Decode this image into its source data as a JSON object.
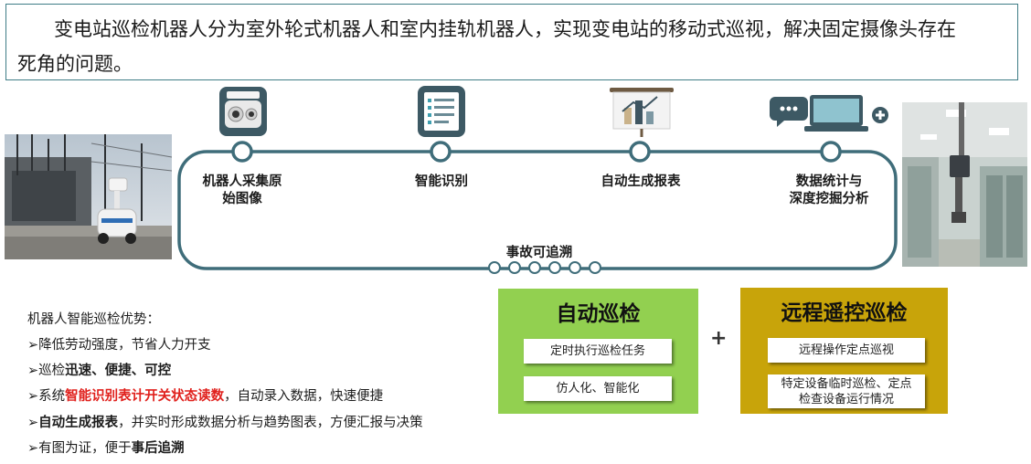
{
  "intro": {
    "line1": "变电站巡检机器人分为室外轮式机器人和室内挂轨机器人，实现变电站的移动式巡视，解决固定摄像头存在",
    "line2": "死角的问题。"
  },
  "flow": {
    "steps": [
      {
        "label_line1": "机器人采集原",
        "label_line2": "始图像",
        "icon": "camera-robot-icon"
      },
      {
        "label_line1": "智能识别",
        "label_line2": "",
        "icon": "checklist-tablet-icon"
      },
      {
        "label_line1": "自动生成报表",
        "label_line2": "",
        "icon": "bar-chart-board-icon"
      },
      {
        "label_line1": "数据统计与",
        "label_line2": "深度挖掘分析",
        "icon": "laptop-chat-icon"
      }
    ],
    "bottom_label": "事故可追溯",
    "accent_color": "#3f6d7a"
  },
  "advantages": {
    "heading": "机器人智能巡检优势：",
    "items": [
      {
        "bullet": "➢",
        "parts": [
          {
            "text": "降低劳动强度，节省人力开支",
            "style": "normal"
          }
        ]
      },
      {
        "bullet": "➢",
        "parts": [
          {
            "text": "巡检",
            "style": "normal"
          },
          {
            "text": "迅速、便捷、可控",
            "style": "bold"
          }
        ]
      },
      {
        "bullet": "➢",
        "parts": [
          {
            "text": "系统",
            "style": "normal"
          },
          {
            "text": "智能识别表计开关状态读数",
            "style": "red"
          },
          {
            "text": "，自动录入数据，快速便捷",
            "style": "normal"
          }
        ]
      },
      {
        "bullet": "➢",
        "parts": [
          {
            "text": "自动生成报表",
            "style": "bold"
          },
          {
            "text": "，并实时形成数据分析与趋势图表，方便汇报与决策",
            "style": "normal"
          }
        ]
      },
      {
        "bullet": "➢",
        "parts": [
          {
            "text": "有图为证，便于",
            "style": "normal"
          },
          {
            "text": "事后追溯",
            "style": "bold"
          }
        ]
      }
    ]
  },
  "auto_panel": {
    "title": "自动巡检",
    "items": [
      "定时执行巡检任务",
      "仿人化、智能化"
    ],
    "color": "#92d050"
  },
  "plus": "+",
  "remote_panel": {
    "title": "远程遥控巡检",
    "item1": "远程操作定点巡视",
    "item2_line1": "特定设备临时巡检、定点",
    "item2_line2": "检查设备运行情况",
    "color": "#c8a40a"
  }
}
